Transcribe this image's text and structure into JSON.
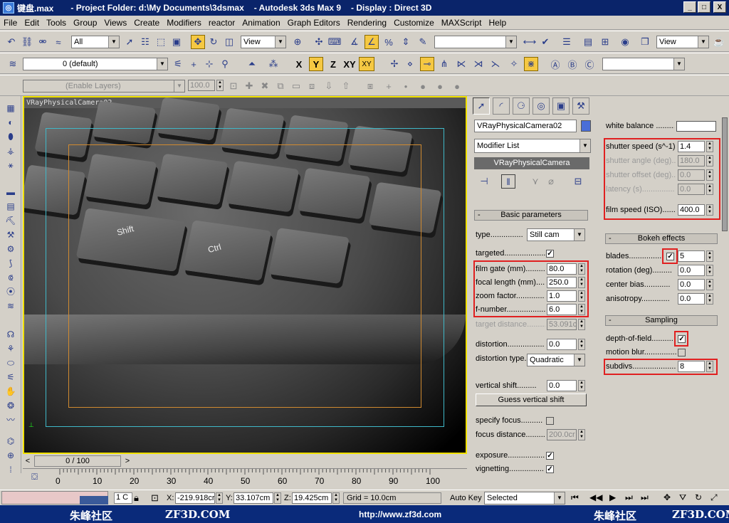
{
  "titlebar": {
    "file": "键盘.max",
    "project": "- Project Folder: d:\\My Documents\\3dsmax",
    "app": "- Autodesk 3ds Max 9",
    "display": "- Display : Direct 3D",
    "minimize": "_",
    "maximize": "□",
    "close": "X"
  },
  "menu": [
    "File",
    "Edit",
    "Tools",
    "Group",
    "Views",
    "Create",
    "Modifiers",
    "reactor",
    "Animation",
    "Graph Editors",
    "Rendering",
    "Customize",
    "MAXScript",
    "Help"
  ],
  "toolbar1": {
    "selection_filter": "All",
    "ref_coord": "View",
    "view_right": "View"
  },
  "toolbar2": {
    "layer": "0 (default)",
    "x": "X",
    "y": "Y",
    "z": "Z",
    "xy": "XY",
    "xy2": "XY"
  },
  "toolbar3": {
    "enable_layers": "(Enable Layers)",
    "value": "100.0"
  },
  "viewport": {
    "label": "VRayPhysicalCamera02",
    "key_shift": "Shift",
    "key_ctrl": "Ctrl"
  },
  "panel": {
    "object_name": "VRayPhysicalCamera02",
    "object_color": "#4a6ed8",
    "modifier_list": "Modifier List",
    "stack_item": "VRayPhysicalCamera",
    "basic": {
      "title": "Basic parameters",
      "minus": "-",
      "type_label": "type...............",
      "type_value": "Still cam",
      "targeted_label": "targeted...................",
      "film_gate_label": "film gate (mm)..........",
      "film_gate": "80.0",
      "focal_length_label": "focal length (mm)......",
      "focal_length": "250.0",
      "zoom_label": "zoom factor.............",
      "zoom": "1.0",
      "fnumber_label": "f-number...................",
      "fnumber": "6.0",
      "target_distance_label": "target distance..........",
      "target_distance": "53.091c",
      "distortion_label": "distortion.................",
      "distortion": "0.0",
      "distortion_type_label": "distortion type.",
      "distortion_type": "Quadratic",
      "vertical_shift_label": "vertical shift.........",
      "vertical_shift": "0.0",
      "guess_button": "Guess vertical shift",
      "specify_focus_label": "specify focus..........",
      "focus_distance_label": "focus distance.........",
      "focus_distance": "200.0cr",
      "exposure_label": "exposure.................",
      "vignetting_label": "vignetting................"
    },
    "right": {
      "white_balance_label": "white balance ..........",
      "shutter_speed_label": "shutter speed (s^-1).",
      "shutter_speed": "1.4",
      "shutter_angle_label": "shutter angle (deg)..",
      "shutter_angle": "180.0",
      "shutter_offset_label": "shutter offset (deg)..",
      "shutter_offset": "0.0",
      "latency_label": "latency (s)...............",
      "latency": "0.0",
      "film_speed_label": "film speed (ISO).......",
      "film_speed": "400.0",
      "bokeh_title": "Bokeh effects",
      "blades_label": "blades.................",
      "blades": "5",
      "rotation_label": "rotation (deg).........",
      "rotation": "0.0",
      "center_bias_label": "center bias............",
      "center_bias": "0.0",
      "anisotropy_label": "anisotropy.............",
      "anisotropy": "0.0",
      "sampling_title": "Sampling",
      "dof_label": "depth-of-field..........",
      "motion_blur_label": "motion blur...............",
      "subdivs_label": "subdivs........................",
      "subdivs": "8",
      "minus": "-"
    }
  },
  "timeline": {
    "frame": "0 / 100",
    "ticks": [
      "0",
      "10",
      "20",
      "30",
      "40",
      "50",
      "60",
      "70",
      "80",
      "90",
      "100"
    ]
  },
  "status": {
    "count": "1 C",
    "x_label": "X:",
    "x": "-219.918cr",
    "y_label": "Y:",
    "y": "33.107cm",
    "z_label": "Z:",
    "z": "19.425cm",
    "grid": "Grid = 10.0cm",
    "auto_key": "Auto Key",
    "selected": "Selected"
  },
  "footer": {
    "brand_left": "朱峰社区",
    "site_left": "ZF3D.COM",
    "url": "http://www.zf3d.com",
    "brand_right": "朱峰社区",
    "site_right": "ZF3D.COM"
  },
  "colors": {
    "accent": "#0a246a",
    "highlight": "#e02020",
    "viewport_border": "#f0e000"
  }
}
